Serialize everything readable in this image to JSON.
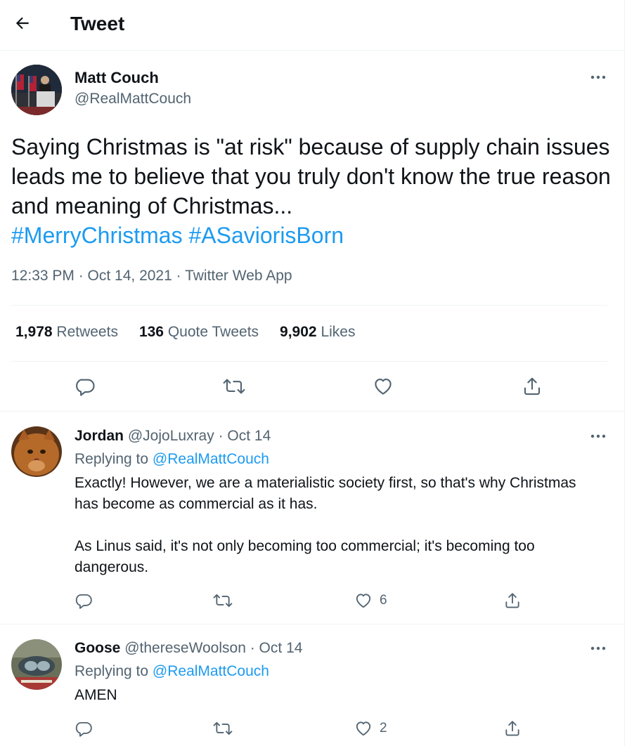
{
  "header": {
    "title": "Tweet"
  },
  "tweet": {
    "author_name": "Matt Couch",
    "author_handle": "@RealMattCouch",
    "text": "Saying Christmas is \"at risk\" because of supply chain issues leads me to believe that you truly don't know the true reason and meaning of Christmas...",
    "hashtags": [
      "#MerryChristmas",
      "#ASaviorisBorn"
    ],
    "meta": "12:33 PM · Oct 14, 2021 · Twitter Web App",
    "stats": {
      "retweets": "1,978",
      "retweets_label": "Retweets",
      "quotes": "136",
      "quotes_label": "Quote Tweets",
      "likes": "9,902",
      "likes_label": "Likes"
    }
  },
  "replies": [
    {
      "name": "Jordan",
      "handle": "@JojoLuxray",
      "date": "· Oct 14",
      "replying_prefix": "Replying to",
      "replying_to": "@RealMattCouch",
      "text_p1": "Exactly! However, we are a materialistic society first, so that's why Christmas has become as commercial as it has.",
      "text_p2": "As Linus said, it's not only becoming too commercial; it's becoming too dangerous.",
      "like_count": "6"
    },
    {
      "name": "Goose",
      "handle": "@thereseWoolson",
      "date": "· Oct 14",
      "replying_prefix": "Replying to",
      "replying_to": "@RealMattCouch",
      "text_p1": "AMEN",
      "like_count": "2"
    }
  ],
  "icons": [
    "back-arrow-icon",
    "more-icon",
    "reply-icon",
    "retweet-icon",
    "like-icon",
    "share-icon"
  ],
  "colors": {
    "accent": "#1d9bf0",
    "secondary_text": "#536471",
    "divider": "#eff3f4"
  }
}
